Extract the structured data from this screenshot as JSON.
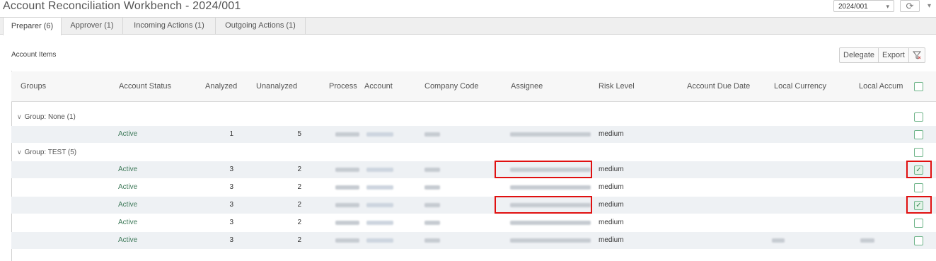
{
  "header": {
    "title": "Account Reconciliation Workbench - 2024/001",
    "period_value": "2024/001",
    "refresh_icon": "refresh-icon"
  },
  "tabs": [
    {
      "label": "Preparer (6)",
      "active": true
    },
    {
      "label": "Approver (1)",
      "active": false
    },
    {
      "label": "Incoming Actions (1)",
      "active": false
    },
    {
      "label": "Outgoing Actions (1)",
      "active": false
    }
  ],
  "section": {
    "title": "Account Items",
    "delegate_label": "Delegate",
    "export_label": "Export",
    "filter_icon": "filter-icon"
  },
  "columns": {
    "groups": "Groups",
    "account_status": "Account Status",
    "analyzed": "Analyzed",
    "unanalyzed": "Unanalyzed",
    "process": "Process",
    "account": "Account",
    "company_code": "Company Code",
    "assignee": "Assignee",
    "risk_level": "Risk Level",
    "account_due_date": "Account Due Date",
    "local_currency": "Local Currency",
    "local_accum": "Local Accum"
  },
  "groups": [
    {
      "label": "Group: None (1)",
      "rows": [
        {
          "status": "Active",
          "analyzed": "1",
          "unanalyzed": "5",
          "risk": "medium",
          "checked": false
        }
      ]
    },
    {
      "label": "Group: TEST (5)",
      "rows": [
        {
          "status": "Active",
          "analyzed": "3",
          "unanalyzed": "2",
          "risk": "medium",
          "checked": true
        },
        {
          "status": "Active",
          "analyzed": "3",
          "unanalyzed": "2",
          "risk": "medium",
          "checked": false
        },
        {
          "status": "Active",
          "analyzed": "3",
          "unanalyzed": "2",
          "risk": "medium",
          "checked": true
        },
        {
          "status": "Active",
          "analyzed": "3",
          "unanalyzed": "2",
          "risk": "medium",
          "checked": false
        },
        {
          "status": "Active",
          "analyzed": "3",
          "unanalyzed": "2",
          "risk": "medium",
          "checked": false
        }
      ]
    }
  ],
  "colors": {
    "status_green": "#3f7a5a",
    "highlight_red": "#e01010",
    "checkbox_green": "#6fb58a"
  }
}
